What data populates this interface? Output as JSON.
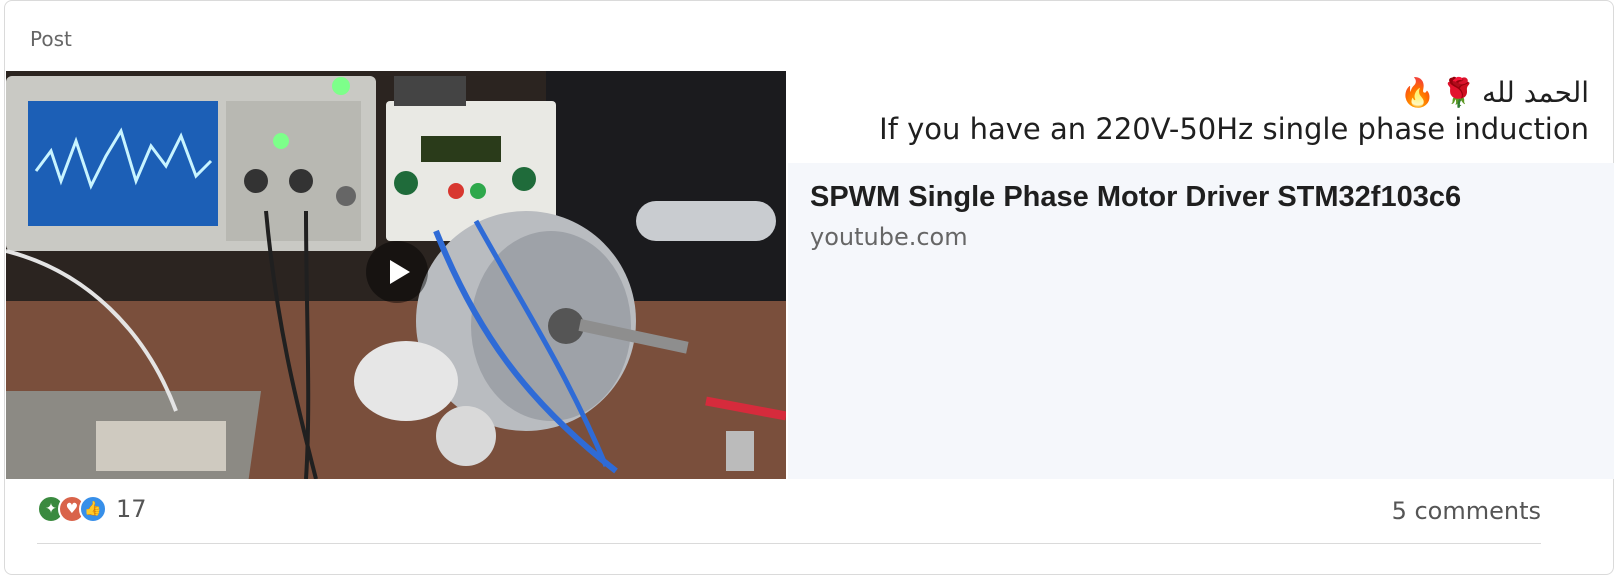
{
  "post": {
    "label": "Post",
    "text_line1": "الحمد لله",
    "text_line1_emojis": [
      "🌹",
      "🔥"
    ],
    "text_line2": "If you have an 220V-50Hz single phase induction"
  },
  "link_preview": {
    "title": "SPWM Single Phase Motor Driver STM32f103c6",
    "domain": "youtube.com"
  },
  "media": {
    "type": "video-thumbnail",
    "play_icon": "play-icon"
  },
  "footer": {
    "reaction_icons": [
      "celebrate-icon",
      "love-icon",
      "like-icon"
    ],
    "reaction_count": "17",
    "comments": "5 comments"
  },
  "colors": {
    "link_preview_bg": "#f5f7fb",
    "like": "#378fe9",
    "love": "#d9634a",
    "celebrate": "#3a8a3f"
  }
}
